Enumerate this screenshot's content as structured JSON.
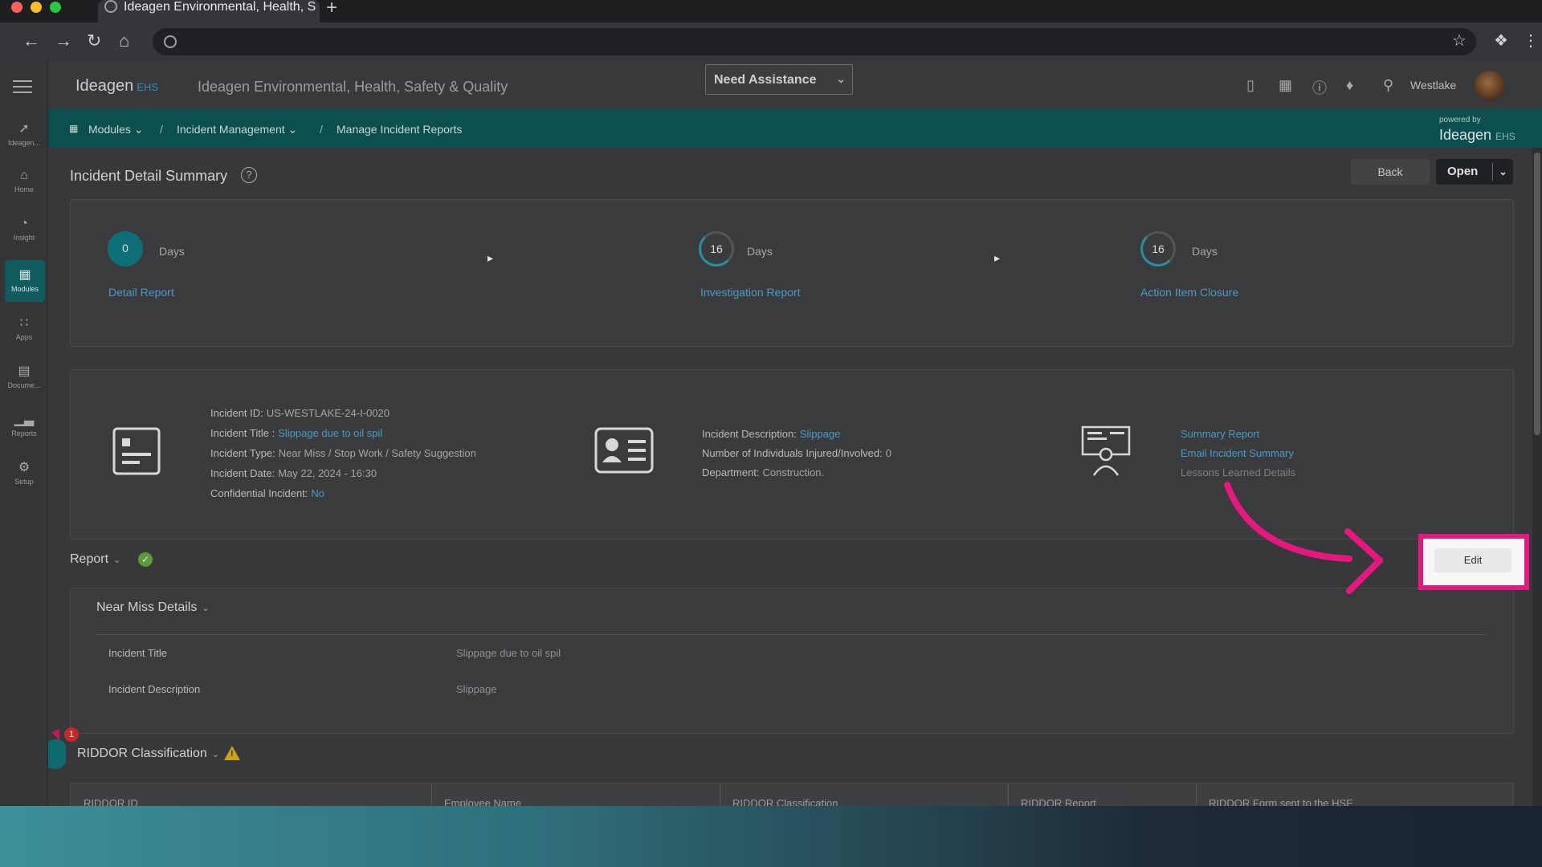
{
  "browser": {
    "tab_title": "Ideagen Environmental, Health, S",
    "new_tab": "+"
  },
  "app": {
    "logo_main": "Ideagen",
    "logo_suffix": "EHS",
    "title": "Ideagen Environmental, Health, Safety & Quality",
    "assist_label": "Need Assistance",
    "location": "Westlake",
    "powered_by": "powered by",
    "powered_logo": "Ideagen",
    "powered_suffix": "EHS"
  },
  "breadcrumb": {
    "modules": "Modules",
    "incident_management": "Incident Management",
    "current": "Manage Incident Reports",
    "sep": "/"
  },
  "rail": {
    "items": [
      {
        "label": "Ideagen...",
        "icon": "ideagen-icon"
      },
      {
        "label": "Home",
        "icon": "home-icon"
      },
      {
        "label": "Insight",
        "icon": "insight-icon"
      },
      {
        "label": "Modules",
        "icon": "modules-icon"
      },
      {
        "label": "Apps",
        "icon": "apps-icon"
      },
      {
        "label": "Docume...",
        "icon": "document-icon"
      },
      {
        "label": "Reports",
        "icon": "reports-icon"
      },
      {
        "label": "Setup",
        "icon": "setup-icon"
      }
    ]
  },
  "page": {
    "title": "Incident Detail Summary",
    "help": "?",
    "back_label": "Back",
    "open_label": "Open"
  },
  "progress": {
    "steps": [
      {
        "value": "0",
        "unit": "Days",
        "label": "Detail Report"
      },
      {
        "value": "16",
        "unit": "Days",
        "label": "Investigation Report"
      },
      {
        "value": "16",
        "unit": "Days",
        "label": "Action Item Closure"
      }
    ]
  },
  "incident": {
    "id_label": "Incident ID:",
    "id_value": "US-WESTLAKE-24-I-0020",
    "title_label": "Incident Title :",
    "title_value": "Slippage due to oil spil",
    "type_label": "Incident Type:",
    "type_value": "Near Miss / Stop Work / Safety Suggestion",
    "date_label": "Incident Date:",
    "date_value": "May 22, 2024 - 16:30",
    "confidential_label": "Confidential Incident:",
    "confidential_value": "No",
    "description_label": "Incident Description:",
    "description_value": "Slippage",
    "injured_label": "Number of Individuals Injured/Involved:",
    "injured_value": "0",
    "department_label": "Department:",
    "department_value": "Construction."
  },
  "links": {
    "summary_report": "Summary Report",
    "email_summary": "Email Incident Summary",
    "lessons_learned": "Lessons Learned Details"
  },
  "report": {
    "section_label": "Report",
    "edit_label": "Edit",
    "near_miss_label": "Near Miss Details",
    "rows": [
      {
        "label": "Incident Title",
        "value": "Slippage due to oil spil"
      },
      {
        "label": "Incident Description",
        "value": "Slippage"
      }
    ],
    "riddor_label": "RIDDOR Classification",
    "riddor_notification_count": "1",
    "table_headers": [
      "RIDDOR ID",
      "Employee Name",
      "RIDDOR Classification",
      "RIDDOR Report",
      "RIDDOR Form sent to the HSE"
    ]
  },
  "colors": {
    "accent_teal": "#0b4f4f",
    "link_blue": "#4a9bc4",
    "highlight_pink": "#e6187e"
  }
}
